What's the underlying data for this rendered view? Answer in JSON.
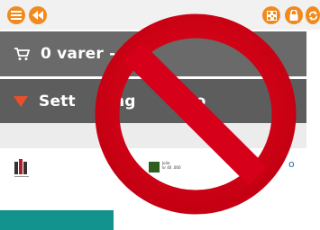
{
  "cart": {
    "label": "0 varer -"
  },
  "sort": {
    "label_left": "Sett",
    "label_mid": "ng",
    "label_right": "nto"
  },
  "footer": {
    "right_letter": "o",
    "logo_b_lines": [
      "Jolie",
      "kr 40 .000"
    ]
  },
  "icons": {
    "menu": "hamburger-menu-icon",
    "back": "rewind-back-icon",
    "qr": "qr-code-icon",
    "lock": "lock-icon",
    "refresh": "refresh-icon",
    "cart": "shopping-cart-icon",
    "caret": "caret-down-icon",
    "prohibited": "prohibited-sign-icon"
  },
  "colors": {
    "accent": "#f08a1e",
    "band": "#6a6a6a",
    "sort_caret": "#e8502a",
    "prohibited": "#e0001a",
    "teal": "#12938e"
  }
}
